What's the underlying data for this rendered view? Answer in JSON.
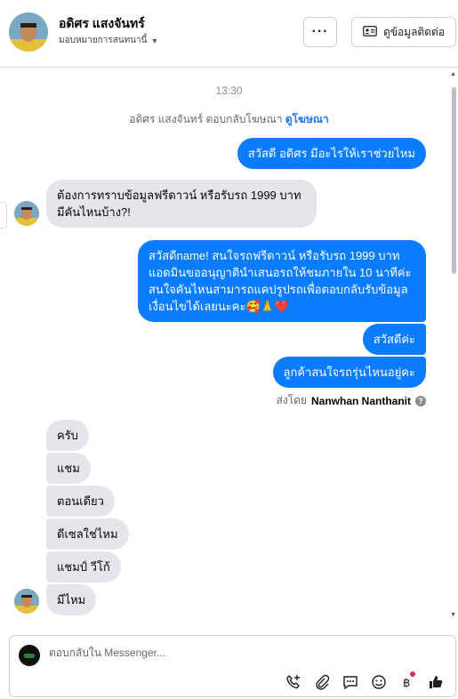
{
  "header": {
    "name": "อดิศร แสงจันทร์",
    "subtitle": "มอบหมายการสนทนานี้",
    "more_label": "···",
    "contact_label": "ดูข้อมูลติดต่อ"
  },
  "thread": {
    "timestamp": "13:30",
    "ad_reply_text": "อดิศร แสงจันทร์ ตอบกลับโฆษณา",
    "ad_link": "ดูโฆษณา",
    "messages": [
      {
        "dir": "out",
        "text": "สวัสดี อดิศร มีอะไรให้เราช่วยไหม"
      },
      {
        "dir": "in",
        "text": "ต้องการทราบข้อมูลฟรีดาวน์ หรือรับรถ 1999 บาท มีคันไหนบ้าง?!"
      },
      {
        "dir": "out",
        "text": "สวัสดีname! สนใจรถฟรีดาวน์ หรือรับรถ 1999 บาท แอดมินขออนุญาตินำเสนอรถให้ชมภายใน 10 นาทีค่ะ สนใจคันไหนสามารถแคปรูปรถเพื่อตอบกลับรับข้อมูลเงื่อนไขได้เลยนะคะ🥰🙏❤️"
      },
      {
        "dir": "out",
        "text": "สวัสดีค่ะ"
      },
      {
        "dir": "out",
        "text": "ลูกค้าสนใจรถรุ่นไหนอยู่คะ"
      },
      {
        "dir": "in",
        "text": "ครับ"
      },
      {
        "dir": "in",
        "text": "แชม"
      },
      {
        "dir": "in",
        "text": "ตอนเดียว"
      },
      {
        "dir": "in",
        "text": "ดีเซลใช่ไหม"
      },
      {
        "dir": "in",
        "text": "แชมป์ วีโก้"
      },
      {
        "dir": "in",
        "text": "มีไหม"
      }
    ],
    "sent_by_prefix": "ส่งโดย",
    "sent_by_name": "Nanwhan Nanthanit",
    "help_mark": "?"
  },
  "composer": {
    "placeholder": "ตอบกลับใน Messenger...",
    "tools": [
      "call-plus-icon",
      "attachment-icon",
      "chat-template-icon",
      "emoji-icon",
      "baht-icon",
      "thumbs-up-icon"
    ]
  },
  "colors": {
    "outgoing": "#0a7cff",
    "incoming": "#e4e6eb",
    "link": "#1877f2",
    "notification_dot": "#f02849"
  }
}
